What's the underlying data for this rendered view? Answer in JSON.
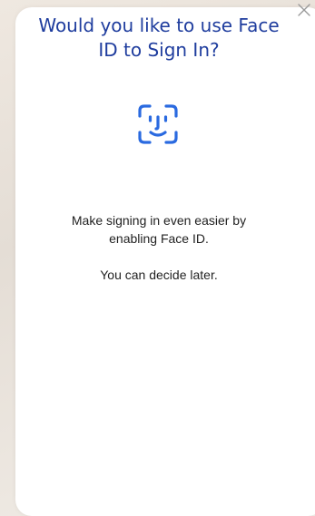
{
  "dialog": {
    "title": "Would you like to use Face ID to Sign In?",
    "message": "Make signing in even easier by enabling Face ID.",
    "secondary_message": "You can decide later."
  },
  "icons": {
    "close": "close-icon",
    "face_id": "face-id-icon"
  },
  "colors": {
    "accent": "#2a6ae0",
    "title": "#1f3d9e",
    "background": "#ffffff"
  }
}
